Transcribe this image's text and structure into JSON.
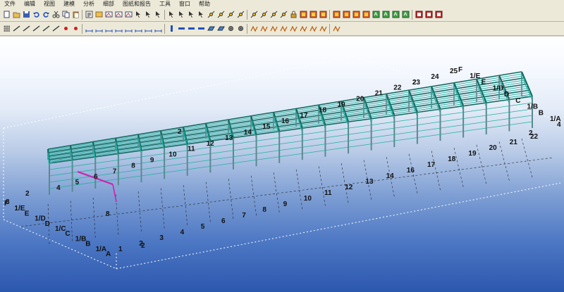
{
  "menu": [
    "文件",
    "编辑",
    "视图",
    "建模",
    "分析",
    "细部",
    "图纸和报告",
    "工具",
    "窗口",
    "帮助"
  ],
  "toolbar1_icons": [
    "new-file",
    "open-folder",
    "save",
    "undo",
    "redo",
    "cut",
    "copy",
    "paste",
    "properties",
    "open-model",
    "view",
    "view",
    "view",
    "select",
    "select",
    "select",
    "select",
    "select",
    "select",
    "select",
    "snap",
    "snap",
    "snap",
    "snap",
    "snap",
    "snap",
    "snap",
    "snap",
    "lock",
    "component",
    "component",
    "component",
    "component",
    "component",
    "component",
    "component",
    "drawing",
    "drawing",
    "drawing",
    "drawing",
    "report",
    "report",
    "report"
  ],
  "toolbar2_icons": [
    "grid",
    "line",
    "line",
    "line",
    "line",
    "line",
    "point",
    "point",
    "measure",
    "measure",
    "measure",
    "measure",
    "measure",
    "measure",
    "measure",
    "measure",
    "column",
    "beam",
    "beam",
    "beam",
    "plate",
    "plate",
    "bolt",
    "bolt",
    "weld",
    "weld",
    "weld",
    "weld",
    "weld",
    "weld",
    "weld",
    "weld",
    "weld"
  ],
  "colors": {
    "member": "#20b0a0",
    "member_dark": "#136b61",
    "selected": "#d020b0",
    "frame_box": "#ffffff"
  },
  "gridlines": {
    "front_numbers": [
      "1",
      "2",
      "3",
      "4",
      "5",
      "6",
      "7",
      "8",
      "9",
      "10",
      "11",
      "12",
      "13",
      "14",
      "16",
      "17",
      "18",
      "19",
      "20",
      "21",
      "22"
    ],
    "back_numbers": [
      "4",
      "5",
      "6",
      "7",
      "8",
      "9",
      "10",
      "11",
      "12",
      "13",
      "14",
      "15",
      "16",
      "17",
      "18",
      "19",
      "20",
      "21",
      "22",
      "23",
      "24",
      "25"
    ],
    "left_letters": [
      "F",
      "1/E",
      "E",
      "1/D",
      "D",
      "1/C",
      "C",
      "1/B",
      "B",
      "1/A",
      "A"
    ],
    "right_letters": [
      "F",
      "1/E",
      "E",
      "1/D",
      "D",
      "C",
      "1/B",
      "B",
      "1/A"
    ],
    "extra_labels": [
      "2",
      "2",
      "2",
      "2",
      "2",
      "4",
      "8",
      "8"
    ]
  }
}
